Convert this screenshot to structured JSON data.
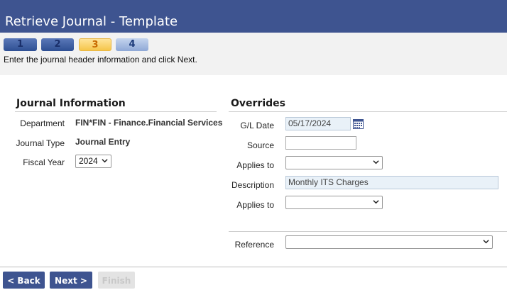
{
  "header": {
    "title": "Retrieve Journal - Template"
  },
  "steps": [
    {
      "label": "1",
      "state": "done"
    },
    {
      "label": "2",
      "state": "done"
    },
    {
      "label": "3",
      "state": "current"
    },
    {
      "label": "4",
      "state": "next"
    }
  ],
  "instructions": "Enter the journal header information and click Next.",
  "journal_info": {
    "title": "Journal Information",
    "department_label": "Department",
    "department_value": "FIN*FIN - Finance.Financial Services",
    "journal_type_label": "Journal Type",
    "journal_type_value": "Journal Entry",
    "fiscal_year_label": "Fiscal Year",
    "fiscal_year_value": "2024"
  },
  "overrides": {
    "title": "Overrides",
    "gl_date_label": "G/L Date",
    "gl_date_value": "05/17/2024",
    "source_label": "Source",
    "source_value": "",
    "applies_to_1_label": "Applies to",
    "applies_to_1_value": "",
    "description_label": "Description",
    "description_value": "Monthly ITS Charges",
    "applies_to_2_label": "Applies to",
    "applies_to_2_value": "",
    "reference_label": "Reference",
    "reference_value": ""
  },
  "buttons": {
    "back": "< Back",
    "next": "Next >",
    "finish": "Finish"
  },
  "colors": {
    "header_bg": "#3e5490",
    "step_current": "#f5c64b",
    "button_primary": "#3e5490"
  }
}
